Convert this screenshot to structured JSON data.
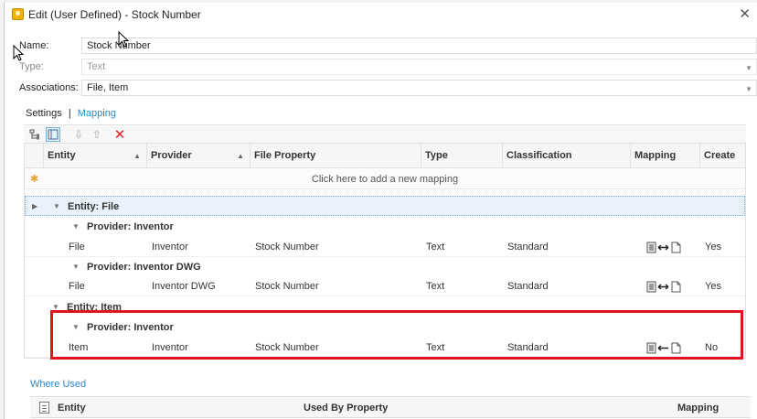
{
  "window": {
    "title": "Edit (User Defined) - Stock Number",
    "close_label": "✕"
  },
  "form": {
    "name_label": "Name:",
    "name_value": "Stock Number",
    "type_label": "Type:",
    "type_value": "Text",
    "assoc_label": "Associations:",
    "assoc_value": "File, Item"
  },
  "tabs": {
    "settings": "Settings",
    "separator": "|",
    "mapping": "Mapping"
  },
  "grid": {
    "columns": [
      "Entity",
      "Provider",
      "File Property",
      "Type",
      "Classification",
      "Mapping",
      "Create"
    ],
    "add_row": "Click here to add a new mapping",
    "groups": {
      "entity_file": "Entity: File",
      "prov_inventor_1": "Provider: Inventor",
      "prov_inventor_dwg": "Provider: Inventor DWG",
      "entity_item": "Entity: Item",
      "prov_inventor_2": "Provider: Inventor"
    },
    "rows": [
      {
        "entity": "File",
        "provider": "Inventor",
        "file_property": "Stock Number",
        "type": "Text",
        "classification": "Standard",
        "mapping": "bidirectional",
        "create": "Yes"
      },
      {
        "entity": "File",
        "provider": "Inventor DWG",
        "file_property": "Stock Number",
        "type": "Text",
        "classification": "Standard",
        "mapping": "bidirectional",
        "create": "Yes"
      },
      {
        "entity": "Item",
        "provider": "Inventor",
        "file_property": "Stock Number",
        "type": "Text",
        "classification": "Standard",
        "mapping": "read-only",
        "create": "No"
      }
    ]
  },
  "where_used": {
    "label": "Where Used",
    "columns": [
      "Entity",
      "Used By Property",
      "Mapping"
    ]
  },
  "colors": {
    "highlight": "#e0141e",
    "link": "#2a87c8",
    "selected_row": "#e9f2fb"
  }
}
